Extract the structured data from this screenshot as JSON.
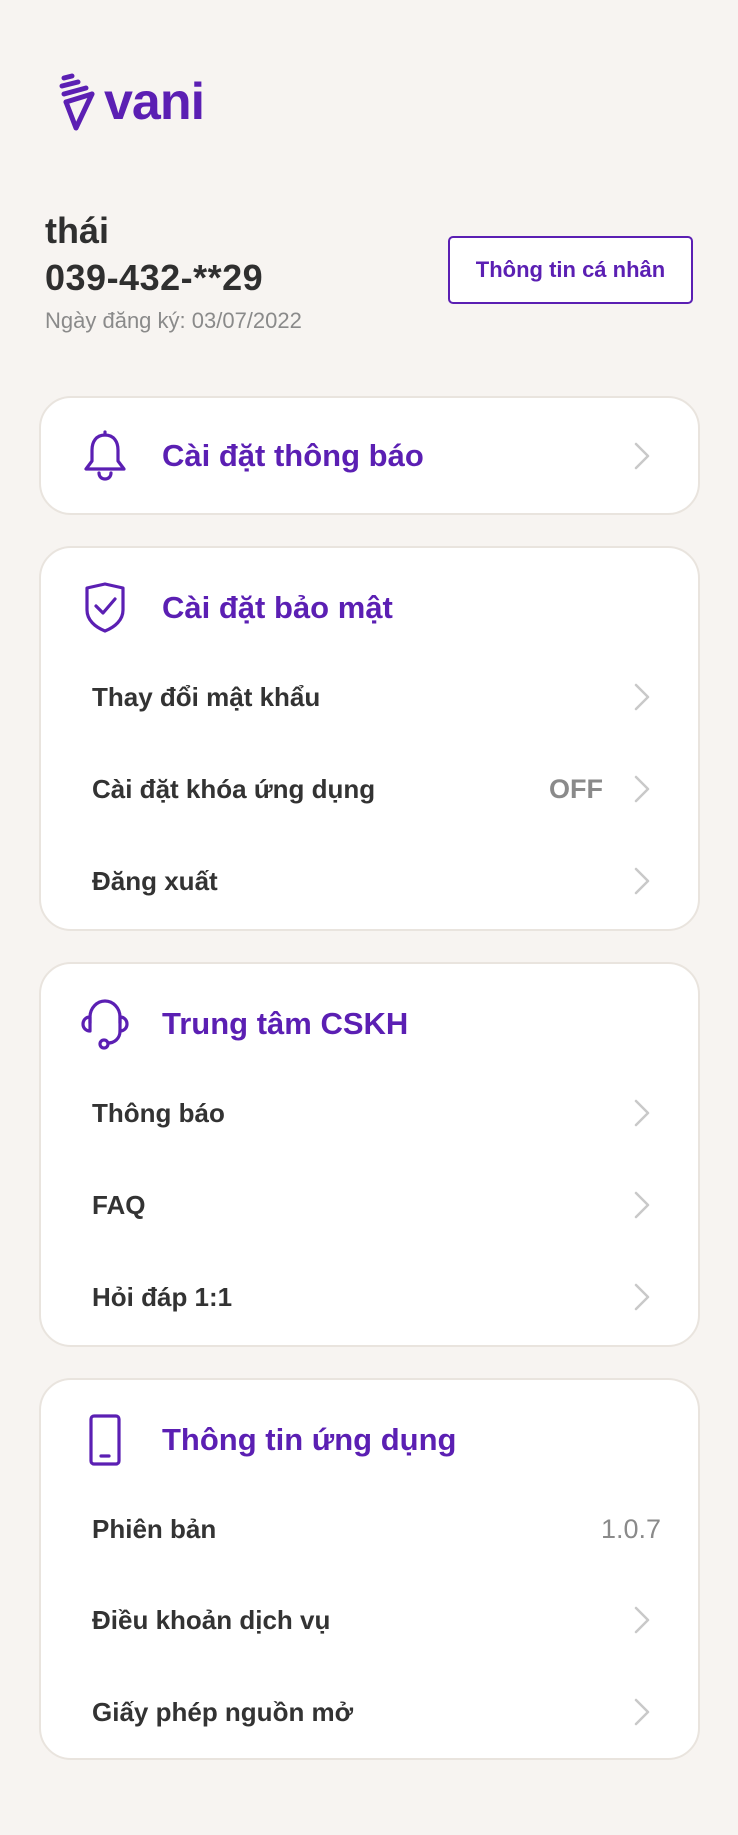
{
  "brand": {
    "name": "vani",
    "color": "#5b1fb3"
  },
  "profile": {
    "name": "thái",
    "phone": "039-432-**29",
    "registered": "Ngày đăng ký: 03/07/2022",
    "button_label": "Thông tin cá nhân"
  },
  "notifications_card": {
    "title": "Cài đặt thông báo",
    "icon": "bell-icon"
  },
  "security_card": {
    "title": "Cài đặt bảo mật",
    "icon": "shield-check-icon",
    "items": [
      {
        "label": "Thay đổi mật khẩu",
        "value": ""
      },
      {
        "label": "Cài đặt khóa ứng dụng",
        "value": "OFF"
      },
      {
        "label": "Đăng xuất",
        "value": ""
      }
    ]
  },
  "support_card": {
    "title": "Trung tâm CSKH",
    "icon": "headset-icon",
    "items": [
      {
        "label": "Thông báo"
      },
      {
        "label": "FAQ"
      },
      {
        "label": "Hỏi đáp 1:1"
      }
    ]
  },
  "app_info_card": {
    "title": "Thông tin ứng dụng",
    "icon": "smartphone-icon",
    "version_label": "Phiên bản",
    "version_value": "1.0.7",
    "items": [
      {
        "label": "Điều khoản dịch vụ"
      },
      {
        "label": "Giấy phép nguồn mở"
      }
    ]
  }
}
